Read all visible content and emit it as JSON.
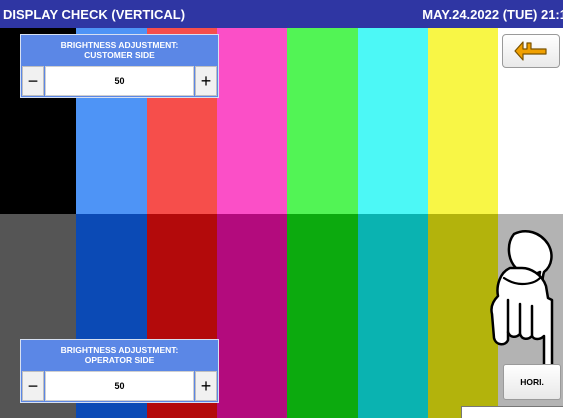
{
  "header": {
    "title": "DISPLAY CHECK (VERTICAL)",
    "datetime": "MAY.24.2022 (TUE)  21:1"
  },
  "color_bars": {
    "top": [
      "#000000",
      "#4e94f6",
      "#f64e4b",
      "#fb4fc7",
      "#52f455",
      "#4cf8f6",
      "#f8f646",
      "#ffffff"
    ],
    "bottom": [
      "#555555",
      "#0b4ab5",
      "#b30a0b",
      "#b30b7d",
      "#0caa0e",
      "#0ab3b1",
      "#b3b30c",
      "#b3b3b3"
    ]
  },
  "customer_panel": {
    "title_line1": "BRIGHTNESS ADJUSTMENT:",
    "title_line2": "CUSTOMER SIDE",
    "minus_label": "−",
    "value": "50",
    "plus_label": "+"
  },
  "operator_panel": {
    "title_line1": "BRIGHTNESS ADJUSTMENT:",
    "title_line2": "OPERATOR SIDE",
    "minus_label": "−",
    "value": "50",
    "plus_label": "+"
  },
  "back_button": {
    "icon": "return-arrow-icon",
    "color": "#f0a000"
  },
  "orientation_button": {
    "label": "HORI."
  },
  "pointer": {
    "icon": "pointing-hand-icon"
  }
}
